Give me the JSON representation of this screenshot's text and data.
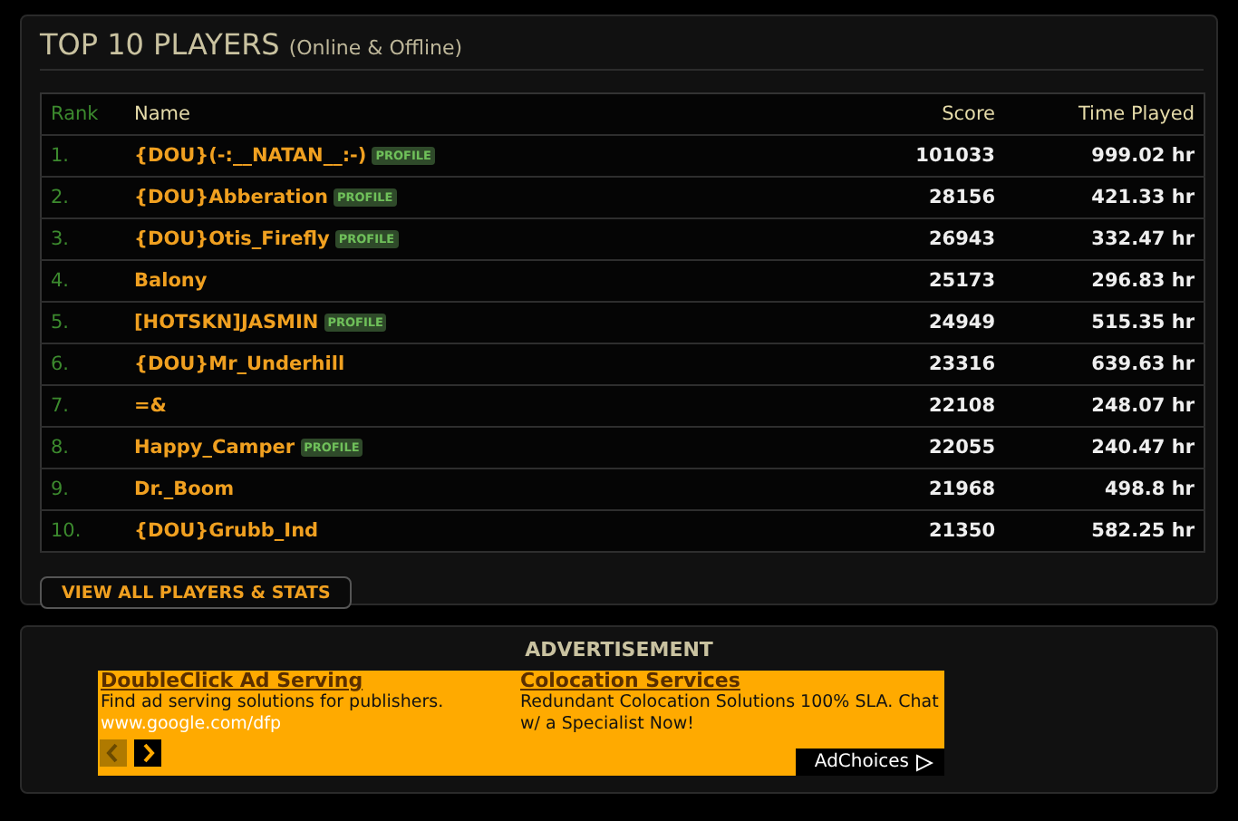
{
  "panel": {
    "title": "TOP 10 PLAYERS",
    "subtitle": "(Online & Offline)"
  },
  "table": {
    "columns": [
      "Rank",
      "Name",
      "Score",
      "Time Played"
    ],
    "rows": [
      {
        "rank": "1.",
        "name": "{DOU}(-:__NATAN__:-)",
        "badge": "PROFILE",
        "score": "101033",
        "time": "999.02 hr"
      },
      {
        "rank": "2.",
        "name": "{DOU}Abberation",
        "badge": "PROFILE",
        "score": "28156",
        "time": "421.33 hr"
      },
      {
        "rank": "3.",
        "name": "{DOU}Otis_Firefly",
        "badge": "PROFILE",
        "score": "26943",
        "time": "332.47 hr"
      },
      {
        "rank": "4.",
        "name": "Balony",
        "score": "25173",
        "time": "296.83 hr"
      },
      {
        "rank": "5.",
        "name": "[HOTSKN]JASMIN",
        "badge": "PROFILE",
        "score": "24949",
        "time": "515.35 hr"
      },
      {
        "rank": "6.",
        "name": "{DOU}Mr_Underhill",
        "score": "23316",
        "time": "639.63 hr"
      },
      {
        "rank": "7.",
        "name": "=&",
        "score": "22108",
        "time": "248.07 hr"
      },
      {
        "rank": "8.",
        "name": "Happy_Camper",
        "badge": "PROFILE",
        "score": "22055",
        "time": "240.47 hr"
      },
      {
        "rank": "9.",
        "name": "Dr._Boom",
        "score": "21968",
        "time": "498.8 hr"
      },
      {
        "rank": "10.",
        "name": "{DOU}Grubb_Ind",
        "score": "21350",
        "time": "582.25 hr"
      }
    ]
  },
  "button": "VIEW ALL PLAYERS & STATS",
  "advertisement": {
    "heading": "ADVERTISEMENT",
    "ads": [
      {
        "title": "DoubleClick Ad Serving",
        "text": "Find ad serving solutions for publishers.",
        "url": "www.google.com/dfp"
      },
      {
        "title": "Colocation Services",
        "text": "Redundant Colocation Solutions 100% SLA. Chat w/ a Specialist Now!"
      }
    ],
    "nav": [
      {
        "disabled": true
      },
      {
        "disabled": false
      }
    ],
    "adchoices": "AdChoices"
  }
}
